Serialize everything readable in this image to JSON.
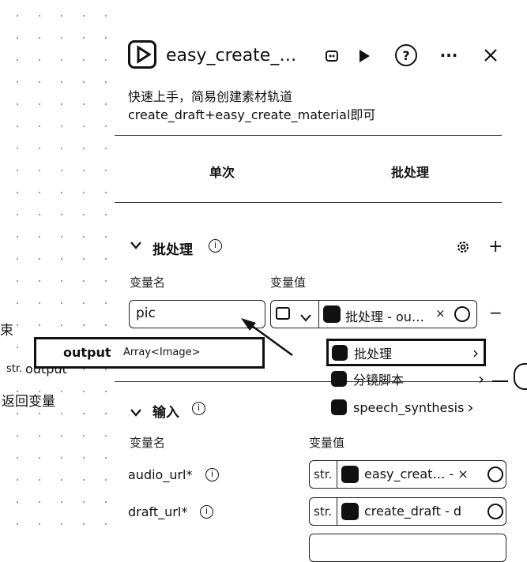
{
  "left": {
    "label_end": "束",
    "output_type": "str.",
    "output_name": "output",
    "return_label": "返回变量"
  },
  "header": {
    "title": "easy_create_…",
    "description": "快速上手，简易创建素材轨道 create_draft+easy_create_material即可"
  },
  "tabs": [
    {
      "label": "单次"
    },
    {
      "label": "批处理"
    }
  ],
  "batch": {
    "title": "批处理",
    "col_name": "变量名",
    "col_value": "变量值",
    "var_name_value": "pic",
    "var_value_text": "批处理 - ou…",
    "minus": "−"
  },
  "popup": {
    "name": "output",
    "type": "Array<Image>"
  },
  "dropdown": {
    "items": [
      {
        "label": "批处理",
        "chevron": "›"
      },
      {
        "label": "分镜脚本",
        "chevron": "›"
      },
      {
        "label": "speech_synthesis",
        "chevron": "›"
      }
    ]
  },
  "input": {
    "title": "输入",
    "col_name": "变量名",
    "col_value": "变量值",
    "rows": [
      {
        "name": "audio_url*",
        "type": "str.",
        "value": "easy_creat…  - ×"
      },
      {
        "name": "draft_url*",
        "type": "str.",
        "value": "create_draft - d"
      }
    ]
  }
}
